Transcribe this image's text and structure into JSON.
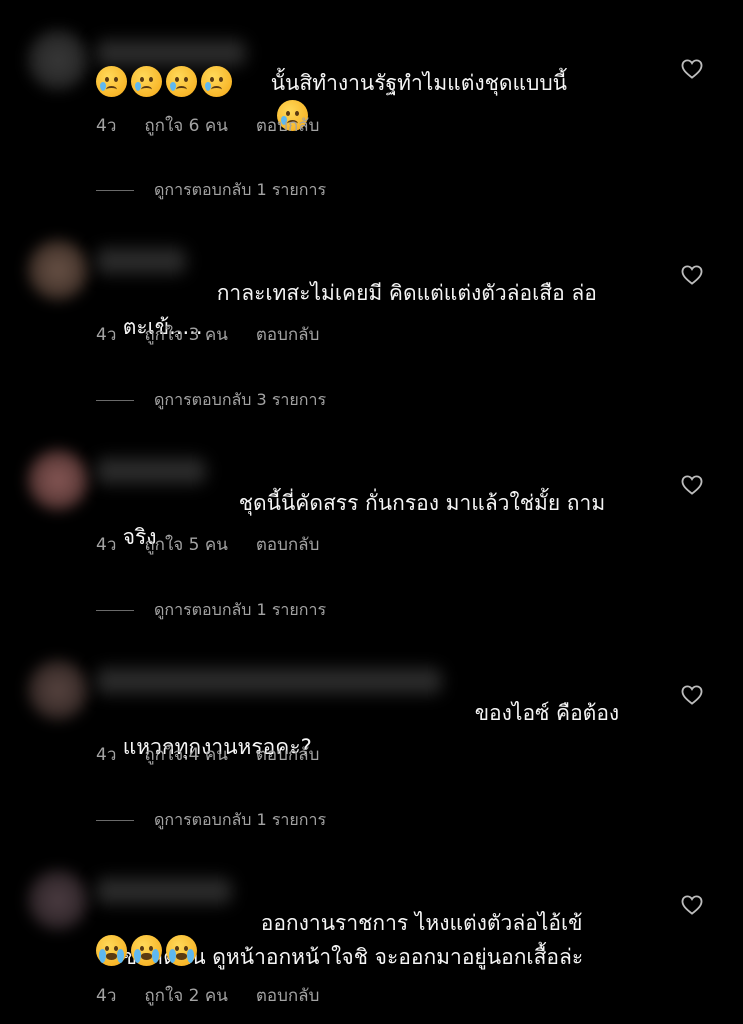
{
  "comments": [
    {
      "text": "นั้นสิทำงานรัฐทำไมแต่งชุดแบบนี้",
      "emoji_inline": "sad-tear",
      "emoji_row": [
        "sad-tear",
        "sad-tear",
        "sad-tear",
        "sad-tear"
      ],
      "time": "4ว",
      "likes": "ถูกใจ 6 คน",
      "reply": "ตอบกลับ",
      "view_replies": "ดูการตอบกลับ 1 รายการ"
    },
    {
      "text_line1": "กาละเทสะไม่เคยมี คิดแต่แต่งตัวล่อเสือ ล่อ",
      "text_line2": "ตะเข้.....",
      "time": "4ว",
      "likes": "ถูกใจ 3 คน",
      "reply": "ตอบกลับ",
      "view_replies": "ดูการตอบกลับ 3 รายการ"
    },
    {
      "text_line1": "ชุดนี้นี่คัดสรร กั่นกรอง มาแล้วใช่มั้ย ถาม",
      "text_line2": "จริง",
      "time": "4ว",
      "likes": "ถูกใจ 5 คน",
      "reply": "ตอบกลับ",
      "view_replies": "ดูการตอบกลับ 1 รายการ"
    },
    {
      "text_line1": "ของไอซ์ คือต้อง",
      "text_line2": "แหวกทุกงานหรอคะ?",
      "time": "4ว",
      "likes": "ถูกใจ 4 คน",
      "reply": "ตอบกลับ",
      "view_replies": "ดูการตอบกลับ 1 รายการ"
    },
    {
      "text_line1": "ออกงานราชการ ไหงแต่งตัวล่อไอ้เข้",
      "text_line2": "ขนาดนั้น ดูหน้าอกหน้าใจชิ จะออกมาอยู่นอกเสื้อล่ะ",
      "emoji_row": [
        "sob",
        "sob",
        "sob"
      ],
      "time": "4ว",
      "likes": "ถูกใจ 2 คน",
      "reply": "ตอบกลับ"
    }
  ],
  "colors": {
    "background": "#000000",
    "text": "#f5f5f5",
    "meta": "#a3a3a3"
  },
  "icons": [
    "heart-outline-icon",
    "sad-tear-emoji",
    "loudly-crying-emoji"
  ]
}
